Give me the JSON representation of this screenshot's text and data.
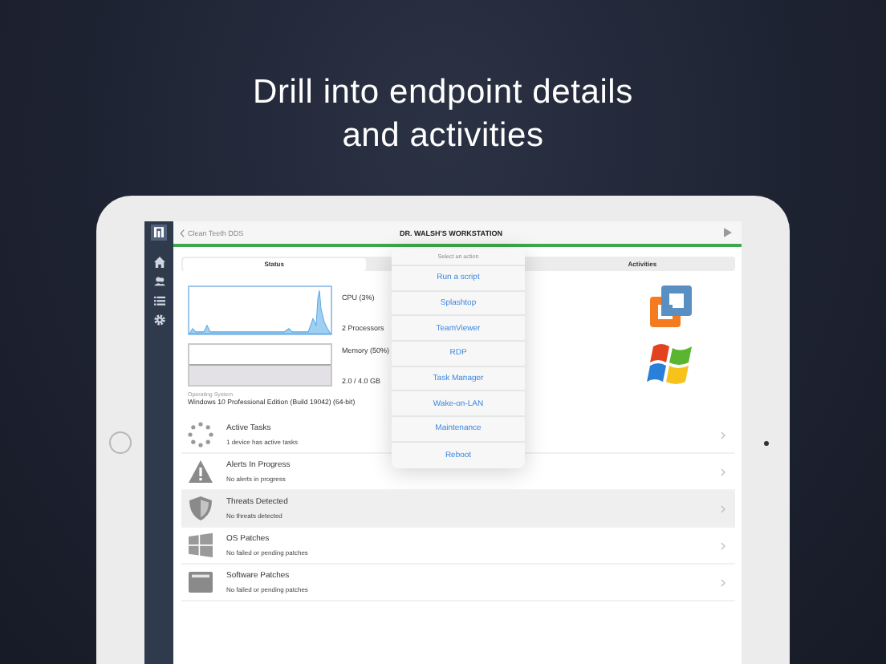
{
  "headline": {
    "lines": [
      "Drill into endpoint details",
      "and activities"
    ]
  },
  "nav": {
    "back": "Clean Teeth DDS",
    "title": "DR. WALSH'S WORKSTATION"
  },
  "sidebar": {
    "items": [
      {
        "kind": "home"
      },
      {
        "kind": "people"
      },
      {
        "kind": "list"
      },
      {
        "kind": "settings"
      }
    ]
  },
  "tabs": [
    {
      "label": "Status",
      "selected": true
    },
    {
      "selected": false
    },
    {
      "label": "Activities",
      "selected": false
    }
  ],
  "cpu": {
    "label": "CPU (3%)",
    "detail": "2 Processors"
  },
  "memory": {
    "label": "Memory (50%)",
    "detail": "2.0 / 4.0 GB"
  },
  "os": {
    "label": "Operating System",
    "value": "Windows 10 Professional Edition (Build 19042) (64-bit)"
  },
  "rows": [
    {
      "kind": "tasks",
      "title": "Active Tasks",
      "subtitle": "1 device has active tasks",
      "selected": false
    },
    {
      "kind": "alert",
      "title": "Alerts In Progress",
      "subtitle": "No alerts in progress",
      "selected": false
    },
    {
      "kind": "shield",
      "title": "Threats Detected",
      "subtitle": "No threats detected",
      "selected": true
    },
    {
      "kind": "windows",
      "title": "OS Patches",
      "subtitle": "No failed or pending patches",
      "selected": false
    },
    {
      "kind": "software",
      "title": "Software Patches",
      "subtitle": "No failed or pending patches",
      "selected": false
    }
  ],
  "popover": {
    "title": "Select an action",
    "actions": [
      "Run a script",
      "Splashtop",
      "TeamViewer",
      "RDP",
      "Task Manager",
      "Wake-on-LAN",
      "Maintenance",
      "Reboot"
    ]
  }
}
